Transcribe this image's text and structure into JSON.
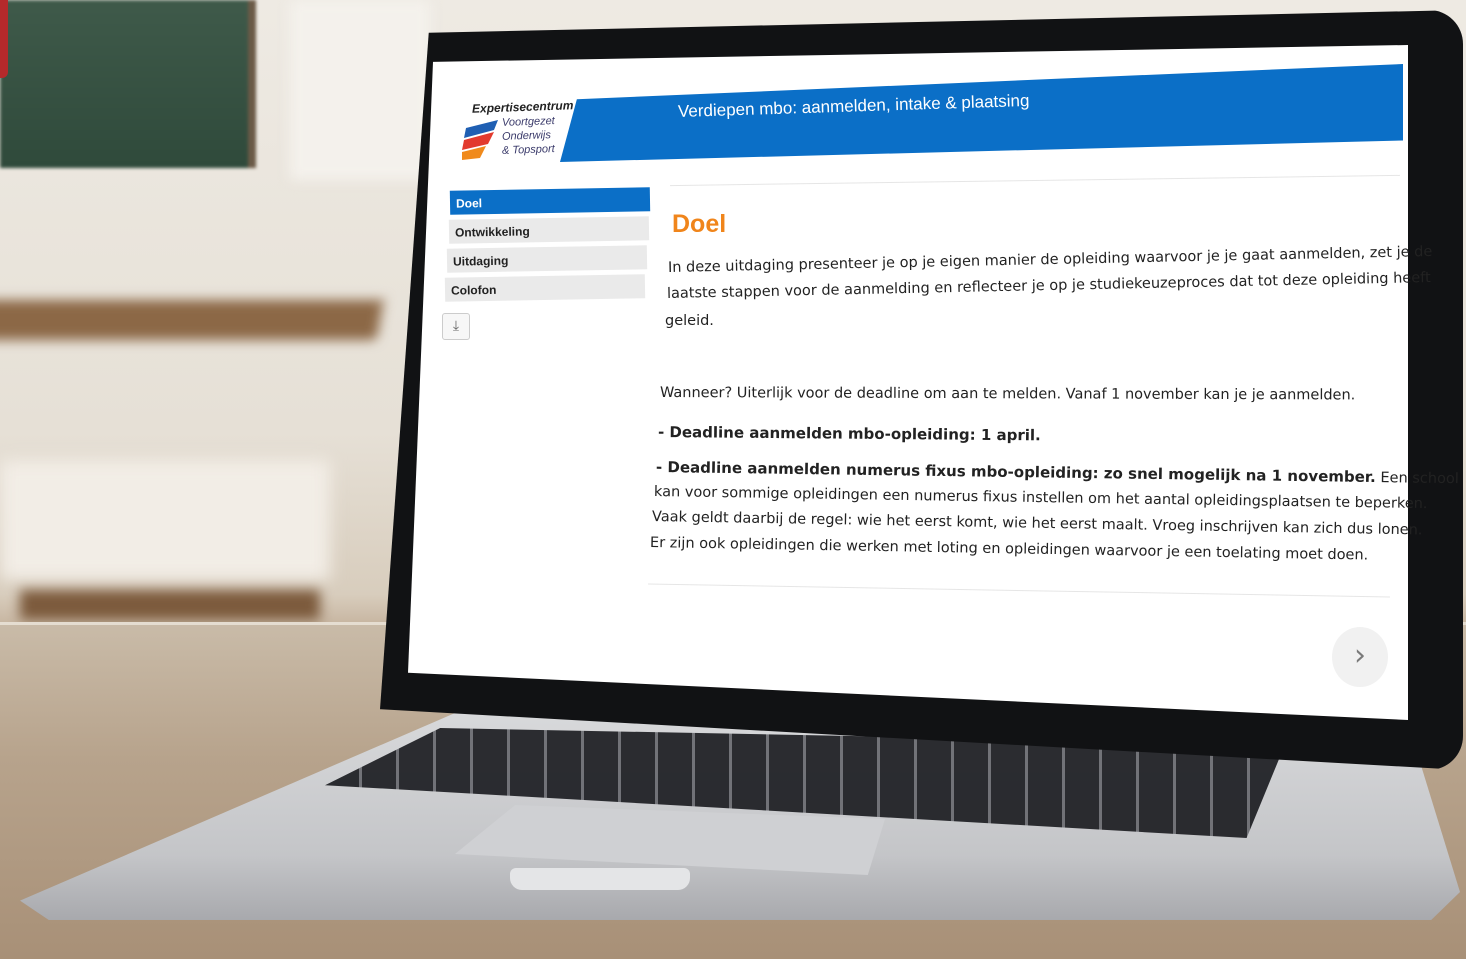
{
  "logo": {
    "title": "Expertisecentrum",
    "lines": [
      "Voortgezet",
      "Onderwijs",
      "& Topsport"
    ]
  },
  "header": {
    "title": "Verdiepen mbo: aanmelden, intake & plaatsing"
  },
  "sidebar": {
    "items": [
      {
        "label": "Doel",
        "active": true
      },
      {
        "label": "Ontwikkeling",
        "active": false
      },
      {
        "label": "Uitdaging",
        "active": false
      },
      {
        "label": "Colofon",
        "active": false
      }
    ],
    "download_icon": "download-icon"
  },
  "content": {
    "title": "Doel",
    "intro_lines": [
      "In deze uitdaging presenteer je op je eigen manier de opleiding waarvoor je je gaat aanmelden, zet je de",
      "laatste stappen voor de aanmelding en reflecteer je op je studiekeuzeproces dat tot deze opleiding heeft",
      "geleid."
    ],
    "when_line": "Wanneer? Uiterlijk voor de deadline om aan te melden. Vanaf 1 november kan je je aanmelden.",
    "deadline_1": "- Deadline aanmelden mbo-opleiding: 1 april.",
    "deadline_2_bold": "- Deadline aanmelden numerus fixus mbo-opleiding: zo snel mogelijk na 1 november.",
    "deadline_2_rest": " Een school",
    "body_lines": [
      "kan voor sommige opleidingen een numerus fixus instellen om het aantal opleidingsplaatsen te beperken.",
      "Vaak geldt daarbij de regel: wie het eerst komt, wie het eerst maalt. Vroeg inschrijven kan zich dus lonen.",
      "Er zijn ook opleidingen die werken met loting en opleidingen waarvoor je een toelating moet doen."
    ]
  },
  "navigation": {
    "next_icon": "chevron-right-icon",
    "next_symbol": "›"
  },
  "colors": {
    "accent_blue": "#0b6fc7",
    "title_orange": "#f0851b"
  }
}
